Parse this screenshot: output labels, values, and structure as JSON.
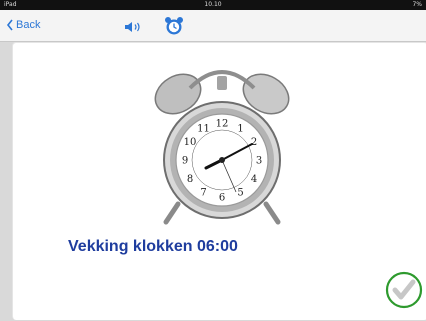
{
  "status_bar": {
    "carrier": "iPad",
    "time": "10.10",
    "battery": "7%"
  },
  "nav": {
    "back_label": "Back"
  },
  "content": {
    "caption": "Vekking klokken 06:00",
    "clock_numbers": [
      "12",
      "1",
      "2",
      "3",
      "4",
      "5",
      "6",
      "7",
      "8",
      "9",
      "10",
      "11"
    ]
  },
  "colors": {
    "accent": "#2c77d6",
    "caption": "#1f3d9e",
    "confirm": "#2e9a2e"
  },
  "icons": {
    "speaker": "speaker-icon",
    "alarm": "alarm-clock-icon",
    "confirm": "checkmark-circle-icon"
  }
}
